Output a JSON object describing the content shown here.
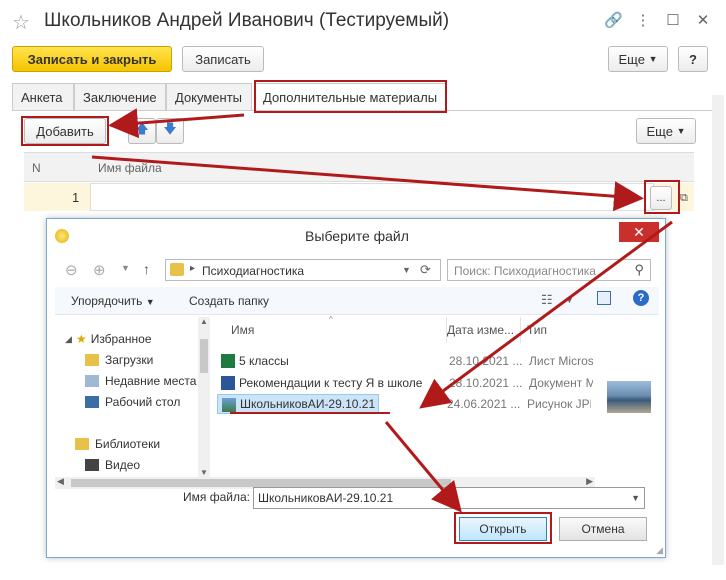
{
  "window": {
    "title": "Школьников Андрей Иванович (Тестируемый)"
  },
  "toolbar": {
    "save_close": "Записать и закрыть",
    "save": "Записать",
    "more": "Еще",
    "help": "?"
  },
  "tabs": [
    {
      "label": "Анкета"
    },
    {
      "label": "Заключение"
    },
    {
      "label": "Документы"
    },
    {
      "label": "Дополнительные материалы"
    }
  ],
  "subtoolbar": {
    "add": "Добавить",
    "more": "Еще"
  },
  "grid": {
    "col_n": "N",
    "col_file": "Имя файла",
    "rows": [
      {
        "n": "1",
        "file": ""
      }
    ],
    "select_btn": "..."
  },
  "dialog": {
    "title": "Выберите файл",
    "close": "✕",
    "address": "Психодиагностика",
    "search_placeholder": "Поиск: Психодиагностика",
    "organize": "Упорядочить",
    "new_folder": "Создать папку",
    "nav": {
      "favorites": "Избранное",
      "downloads": "Загрузки",
      "recent": "Недавние места",
      "desktop": "Рабочий стол",
      "libraries": "Библиотеки",
      "video": "Видео"
    },
    "columns": {
      "name": "Имя",
      "date": "Дата изме...",
      "type": "Тип"
    },
    "files": [
      {
        "name": "5 классы",
        "date": "28.10.2021 ...",
        "type": "Лист Micros"
      },
      {
        "name": "Рекомендации к тесту Я в школе",
        "date": "28.10.2021 ...",
        "type": "Документ M"
      },
      {
        "name": "ШкольниковАИ-29.10.21",
        "date": "24.06.2021 ...",
        "type": "Рисунок JPE"
      }
    ],
    "filename_label": "Имя файла:",
    "filename_value": "ШкольниковАИ-29.10.21",
    "open": "Открыть",
    "cancel": "Отмена"
  },
  "colors": {
    "accent_yellow": "#f5c400",
    "highlight_red": "#b11a1a",
    "selection_blue": "#cce4f7"
  }
}
